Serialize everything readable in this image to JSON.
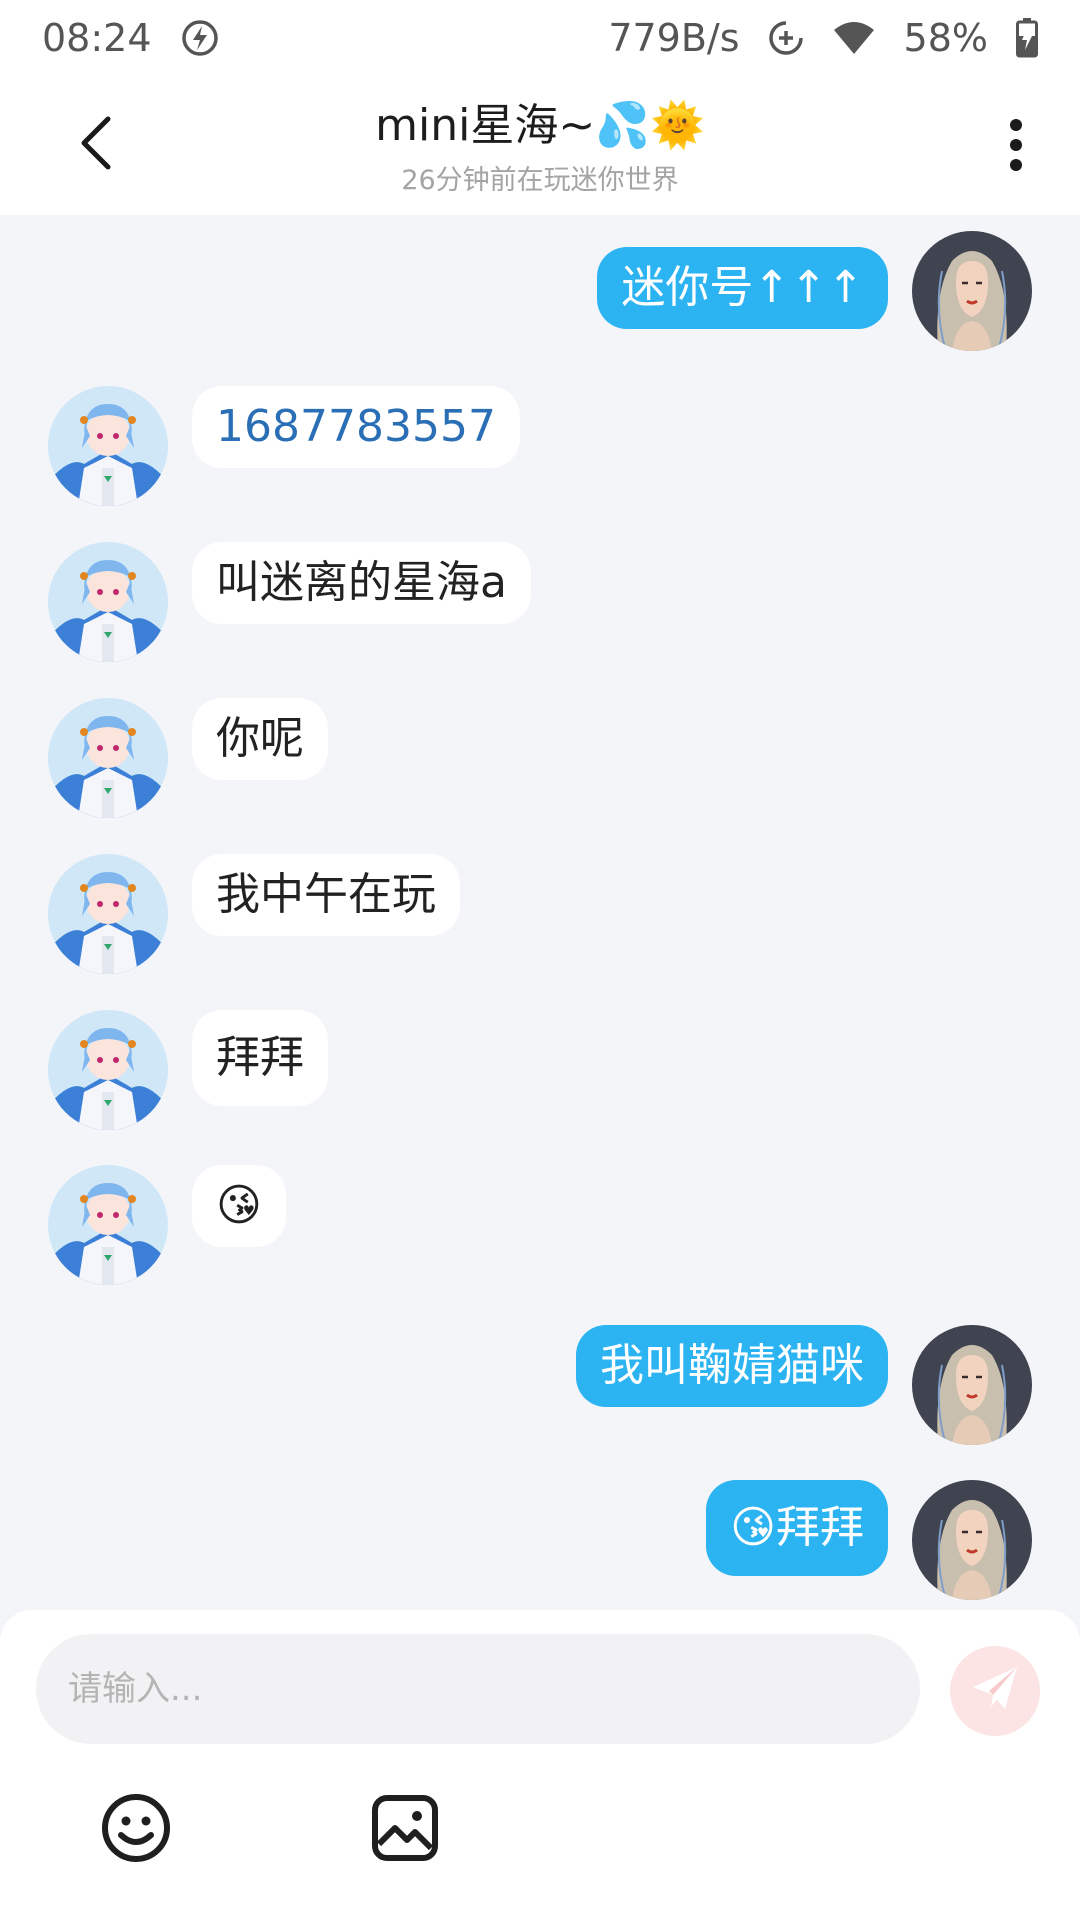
{
  "status_bar": {
    "time": "08:24",
    "net_speed": "779B/s",
    "battery": "58%"
  },
  "header": {
    "title": "mini星海~💦🌞",
    "subtitle": "26分钟前在玩迷你世界"
  },
  "messages": [
    {
      "direction": "out",
      "text": "迷你号↑↑↑"
    },
    {
      "direction": "in",
      "text": "1687783557"
    },
    {
      "direction": "in",
      "text": "叫迷离的星海a"
    },
    {
      "direction": "in",
      "text": "你呢"
    },
    {
      "direction": "in",
      "text": "我中午在玩"
    },
    {
      "direction": "in",
      "text": "拜拜"
    },
    {
      "direction": "in",
      "text": "😘"
    },
    {
      "direction": "out",
      "text": "我叫鞠婧猫咪"
    },
    {
      "direction": "out",
      "text": "😘拜拜"
    }
  ],
  "composer": {
    "placeholder": "请输入..."
  },
  "icons": {
    "back": "chevron-left-icon",
    "more": "more-vertical-icon",
    "send": "send-icon",
    "emoji": "emoji-icon",
    "image": "image-icon"
  },
  "colors": {
    "outgoing_bubble": "#2cb3f2",
    "incoming_bubble": "#ffffff",
    "link_text": "#2a6fb5",
    "send_button": "#fde4e4",
    "background": "#f4f5f9"
  }
}
